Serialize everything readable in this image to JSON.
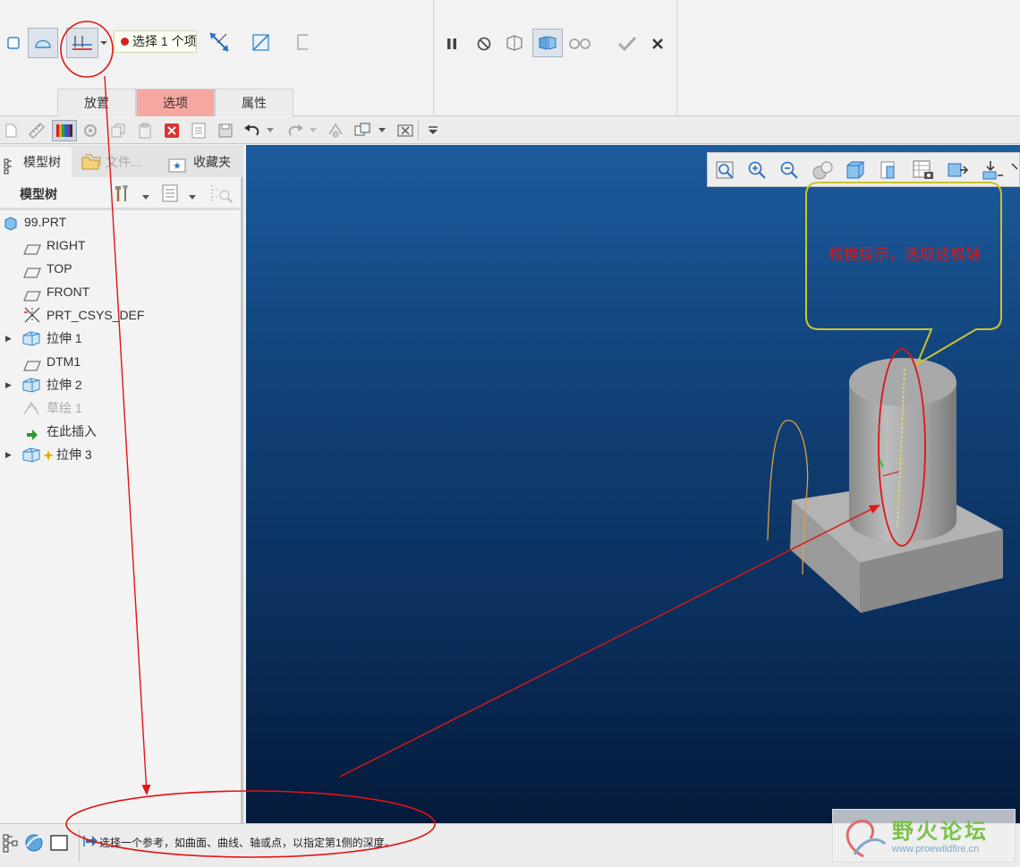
{
  "dashboard": {
    "select_ref_text": "选择 1 个项",
    "tabs": [
      {
        "label": "放置"
      },
      {
        "label": "选项"
      },
      {
        "label": "属性"
      }
    ]
  },
  "navigator": {
    "tabs": [
      {
        "label": "模型树"
      },
      {
        "label": "文件..."
      },
      {
        "label": "收藏夹"
      }
    ],
    "tree_title": "模型树",
    "items": [
      {
        "label": "99.PRT"
      },
      {
        "label": "RIGHT"
      },
      {
        "label": "TOP"
      },
      {
        "label": "FRONT"
      },
      {
        "label": "PRT_CSYS_DEF"
      },
      {
        "label": "拉伸 1"
      },
      {
        "label": "DTM1"
      },
      {
        "label": "拉伸 2"
      },
      {
        "label": "草绘 1"
      },
      {
        "label": "在此插入"
      },
      {
        "label": "拉伸 3"
      }
    ]
  },
  "graphics": {
    "callout_text": "根据提示，选取这根轴"
  },
  "status": {
    "message": "选择一个参考，如曲面、曲线、轴或点，以指定第1侧的深度。"
  },
  "watermark": {
    "title": "野火论坛",
    "url": "www.proewildfire.cn"
  },
  "colors": {
    "annotation_red": "#e01515",
    "callout_yellow": "#c9c430",
    "active_tab": "#f6a7a2",
    "axis_yellow": "#e8e05a",
    "sketch_orange": "#e0a040"
  }
}
